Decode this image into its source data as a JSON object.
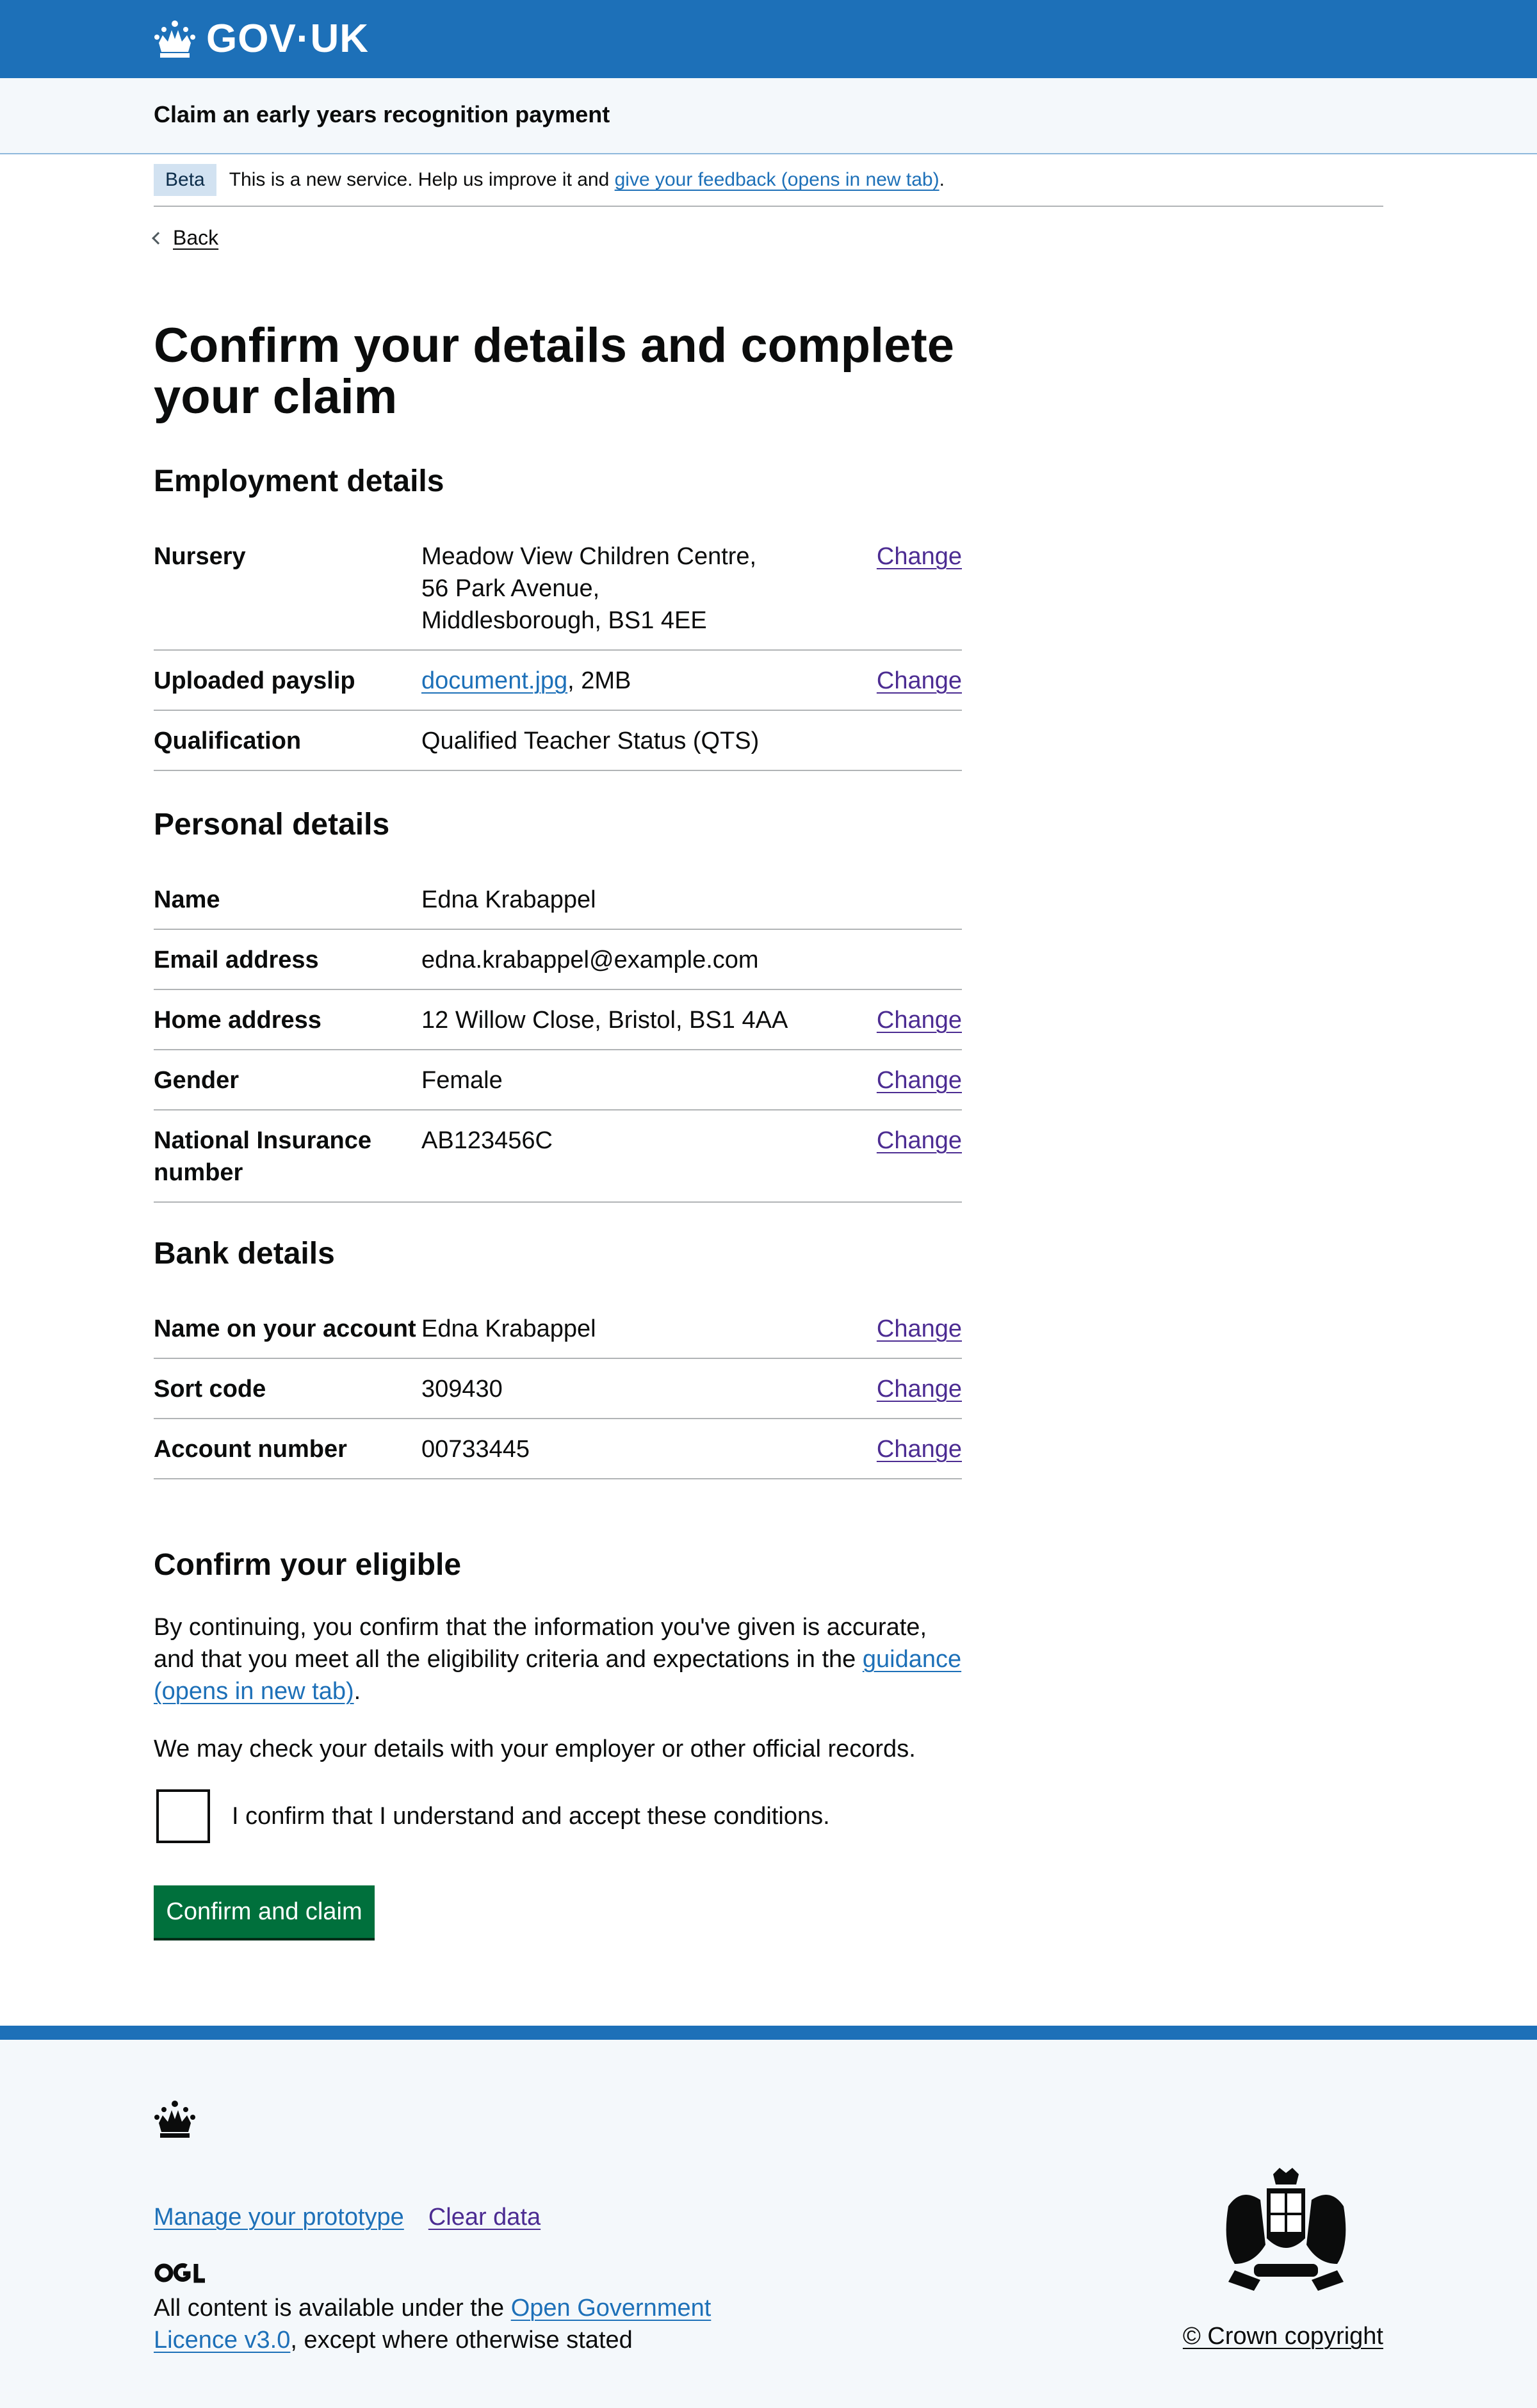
{
  "header": {
    "logotype": "GOV·UK",
    "logo_icon": "crown-icon",
    "brand_color": "#1d70b8"
  },
  "service": {
    "name": "Claim an early years recognition payment"
  },
  "phase": {
    "tag": "Beta",
    "text_before": "This is a new service. Help us improve it and ",
    "link": "give your feedback (opens in new tab)",
    "text_after": "."
  },
  "back": {
    "label": "Back"
  },
  "title": "Confirm your details and complete your claim",
  "employment": {
    "heading": "Employment details",
    "rows": [
      {
        "key": "Nursery",
        "value_lines": [
          "Meadow View Children Centre,",
          "56 Park Avenue,",
          "Middlesborough, BS1 4EE"
        ],
        "action": "Change"
      },
      {
        "key": "Uploaded payslip",
        "value_link": "document.jpg",
        "value_suffix": ", 2MB",
        "action": "Change"
      },
      {
        "key": "Qualification",
        "value": "Qualified Teacher Status (QTS)"
      }
    ]
  },
  "personal": {
    "heading": "Personal details",
    "rows": [
      {
        "key": "Name",
        "value": "Edna Krabappel"
      },
      {
        "key": "Email address",
        "value": "edna.krabappel@example.com"
      },
      {
        "key": "Home address",
        "value": "12 Willow Close, Bristol, BS1 4AA",
        "action": "Change"
      },
      {
        "key": "Gender",
        "value": "Female",
        "action": "Change"
      },
      {
        "key": "National Insurance number",
        "value": "AB123456C",
        "action": "Change"
      }
    ]
  },
  "bank": {
    "heading": "Bank details",
    "rows": [
      {
        "key": "Name on your account",
        "value": "Edna Krabappel",
        "action": "Change"
      },
      {
        "key": "Sort code",
        "value": "309430",
        "action": "Change"
      },
      {
        "key": "Account number",
        "value": "00733445",
        "action": "Change"
      }
    ]
  },
  "confirm": {
    "heading": "Confirm your eligible",
    "para1_before": "By continuing, you confirm that the information you've given is accurate, and that you meet all the eligibility criteria and expectations in the ",
    "para1_link": "guidance (opens in new tab)",
    "para1_after": ".",
    "para2": "We may check your details with your employer or other official records.",
    "checkbox_label": "I confirm that I understand and accept these conditions.",
    "button": "Confirm and claim",
    "button_color": "#00703c"
  },
  "footer": {
    "links": [
      "Manage your prototype",
      "Clear data"
    ],
    "ogl_icon": "ogl-logo-icon",
    "licence_before": "All content is available under the ",
    "licence_link": "Open Government Licence v3.0",
    "licence_after": ", except where otherwise stated",
    "copyright": "© Crown copyright"
  }
}
